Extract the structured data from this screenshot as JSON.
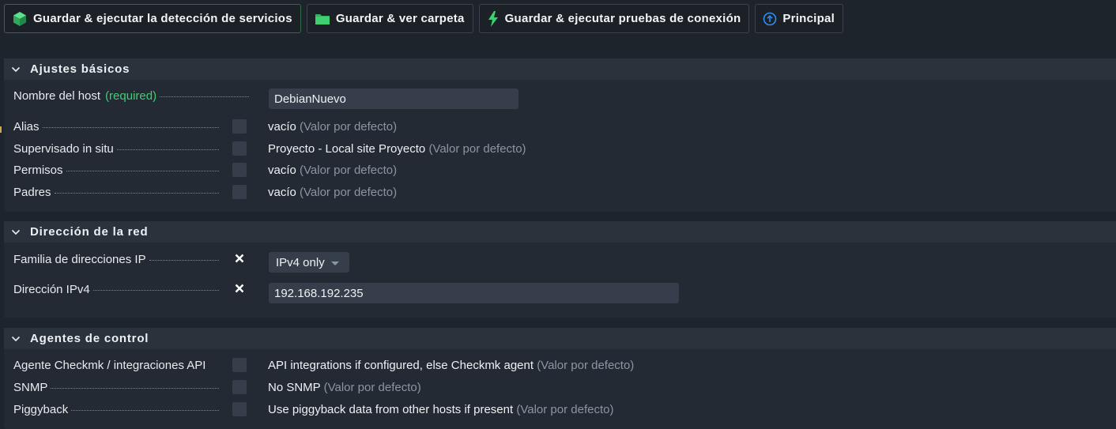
{
  "toolbar": {
    "buttons": [
      {
        "label": "Guardar & ejecutar la detección de servicios",
        "icon": "cube-icon"
      },
      {
        "label": "Guardar & ver carpeta",
        "icon": "folder-icon"
      },
      {
        "label": "Guardar & ejecutar pruebas de conexión",
        "icon": "lightning-icon"
      },
      {
        "label": "Principal",
        "icon": "arrow-up-circle-icon"
      }
    ]
  },
  "sections": {
    "basic": {
      "title": "Ajustes básicos",
      "hostname_label": "Nombre del host",
      "hostname_required": "(required)",
      "hostname_value": "DebianNuevo",
      "alias_label": "Alias",
      "alias_value": "vacío",
      "supervisado_label": "Supervisado in situ",
      "supervisado_value": "Proyecto - Local site Proyecto",
      "permisos_label": "Permisos",
      "permisos_value": "vacío",
      "padres_label": "Padres",
      "padres_value": "vacío",
      "default_text": "(Valor por defecto)"
    },
    "network": {
      "title": "Dirección de la red",
      "family_label": "Familia de direcciones IP",
      "family_value": "IPv4 only",
      "ipv4_label": "Dirección IPv4",
      "ipv4_value": "192.168.192.235"
    },
    "agents": {
      "title": "Agentes de control",
      "checkmk_label": "Agente Checkmk / integraciones API",
      "checkmk_value": "API integrations if configured, else Checkmk agent",
      "snmp_label": "SNMP",
      "snmp_value": "No SNMP",
      "piggyback_label": "Piggyback",
      "piggyback_value": "Use piggyback data from other hosts if present",
      "default_text": "(Valor por defecto)"
    }
  },
  "colors": {
    "background": "#1e242c",
    "section_header": "#2a323c",
    "accent_green": "#3ecf73",
    "muted_text": "#8b96a2",
    "principal_icon": "#2d8ff0"
  }
}
